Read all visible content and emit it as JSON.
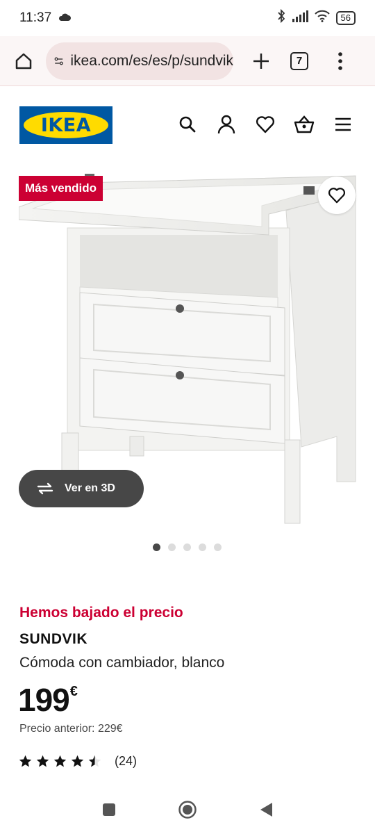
{
  "status_bar": {
    "time": "11:37",
    "battery": "56"
  },
  "browser": {
    "url": "ikea.com/es/es/p/sundvik",
    "tab_count": "7"
  },
  "header": {
    "logo_text": "IKEA"
  },
  "product": {
    "badge": "Más vendido",
    "view_3d_label": "Ver en 3D",
    "carousel_total": 5,
    "carousel_active": 1,
    "price_notice": "Hemos bajado el precio",
    "name": "SUNDVIK",
    "description": "Cómoda con cambiador, blanco",
    "price": "199",
    "currency": "€",
    "previous_price_label": "Precio anterior:",
    "previous_price": "229€",
    "rating_stars": 4.5,
    "rating_count": "(24)"
  },
  "colors": {
    "ikea_blue": "#0058a3",
    "ikea_yellow": "#ffdb00",
    "sale_red": "#cc0033"
  }
}
